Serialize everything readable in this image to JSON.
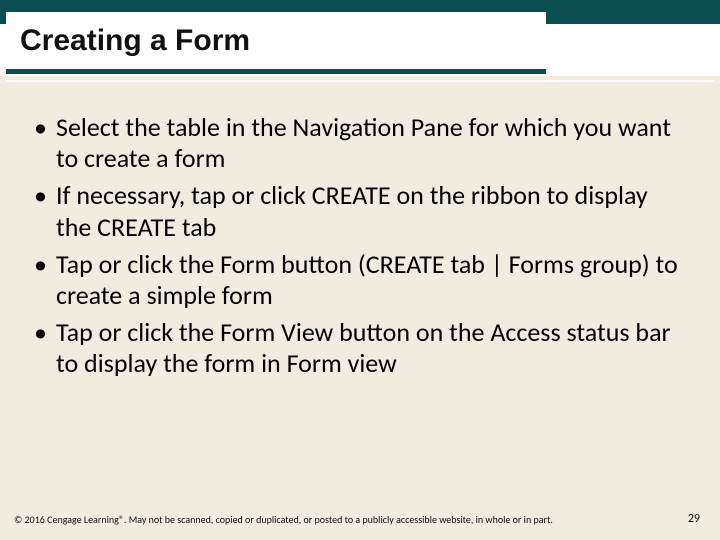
{
  "slide": {
    "title": "Creating a Form",
    "bullets": [
      "Select the table in the Navigation Pane for which you want to create a form",
      "If necessary, tap or click CREATE on the ribbon to display the CREATE tab",
      "Tap or click the Form button (CREATE tab | Forms group) to create a simple form",
      "Tap or click the Form View button on the Access status bar to display the form in Form view"
    ],
    "footer": {
      "copyright": "© 2016 Cengage Learning®. May not be scanned, copied or duplicated, or posted to a publicly accessible website, in whole or in part.",
      "page_number": "29"
    }
  }
}
